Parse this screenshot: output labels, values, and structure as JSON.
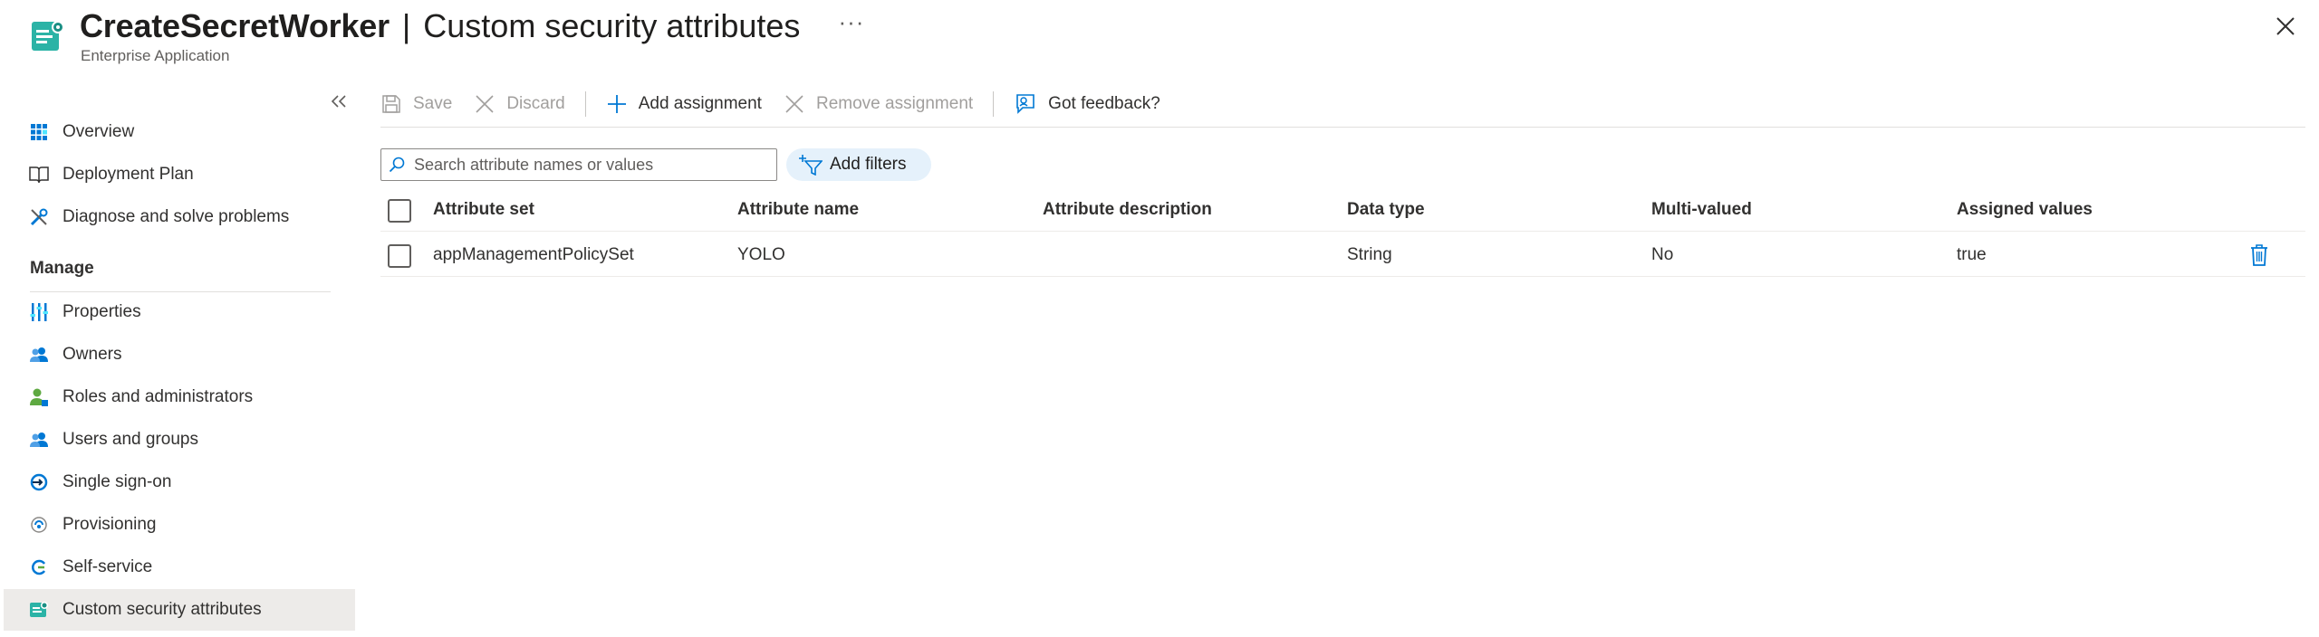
{
  "header": {
    "app_name": "CreateSecretWorker",
    "separator": "|",
    "page_name": "Custom security attributes",
    "more": "···",
    "subtitle": "Enterprise Application"
  },
  "sidebar": {
    "items": [
      {
        "label": "Overview",
        "icon": "grid-icon"
      },
      {
        "label": "Deployment Plan",
        "icon": "book-icon"
      },
      {
        "label": "Diagnose and solve problems",
        "icon": "wrench-icon"
      }
    ],
    "section_title": "Manage",
    "manage_items": [
      {
        "label": "Properties",
        "icon": "sliders-icon"
      },
      {
        "label": "Owners",
        "icon": "people-icon"
      },
      {
        "label": "Roles and administrators",
        "icon": "person-admin-icon"
      },
      {
        "label": "Users and groups",
        "icon": "people-icon"
      },
      {
        "label": "Single sign-on",
        "icon": "sso-icon"
      },
      {
        "label": "Provisioning",
        "icon": "provisioning-icon"
      },
      {
        "label": "Self-service",
        "icon": "self-service-icon"
      },
      {
        "label": "Custom security attributes",
        "icon": "custom-attributes-icon",
        "active": true
      }
    ]
  },
  "toolbar": {
    "save": "Save",
    "discard": "Discard",
    "add_assignment": "Add assignment",
    "remove_assignment": "Remove assignment",
    "feedback": "Got feedback?"
  },
  "search": {
    "placeholder": "Search attribute names or values"
  },
  "filter": {
    "label": "Add filters"
  },
  "table": {
    "columns": [
      "Attribute set",
      "Attribute name",
      "Attribute description",
      "Data type",
      "Multi-valued",
      "Assigned values"
    ],
    "rows": [
      {
        "attribute_set": "appManagementPolicySet",
        "attribute_name": "YOLO",
        "attribute_description": "",
        "data_type": "String",
        "multi_valued": "No",
        "assigned_values": "true"
      }
    ]
  },
  "colors": {
    "accent": "#0078d4",
    "app_icon": "#2bb3a6",
    "active_nav": "#edebe9"
  }
}
